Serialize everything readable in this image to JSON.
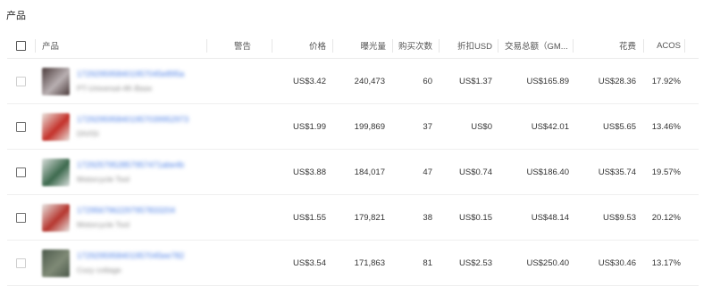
{
  "section_title": "产品",
  "columns": {
    "product": "产品",
    "warning": "警告",
    "price": "价格",
    "impressions": "曝光量",
    "purchases": "购买次数",
    "discount": "折扣USD",
    "gmv": "交易总额（GM...",
    "spend": "花费",
    "acos": "ACOS"
  },
  "rows": [
    {
      "product_id": "1729295958401957045e895a",
      "product_name": "PT-Universal-4K-Base",
      "thumb_colors": [
        "#4b3b3b",
        "#b9b0b2"
      ],
      "price": "US$3.42",
      "impressions": "240,473",
      "purchases": "60",
      "discount": "US$1.37",
      "gmv": "US$165.89",
      "spend": "US$28.36",
      "acos": "17.92%"
    },
    {
      "product_id": "1729295958401957039952973",
      "product_name": "DIVISI",
      "thumb_colors": [
        "#e9e3dd",
        "#c4312a"
      ],
      "price": "US$1.99",
      "impressions": "199,869",
      "purchases": "37",
      "discount": "US$0",
      "gmv": "US$42.01",
      "spend": "US$5.65",
      "acos": "13.46%"
    },
    {
      "product_id": "1729257952857957471abe4b",
      "product_name": "Motorcycle Tool",
      "thumb_colors": [
        "#d8dedb",
        "#3d6a4e"
      ],
      "price": "US$3.88",
      "impressions": "184,017",
      "purchases": "47",
      "discount": "US$0.74",
      "gmv": "US$186.40",
      "spend": "US$35.74",
      "acos": "19.57%"
    },
    {
      "product_id": "1729567962297957833204",
      "product_name": "Motorcycle Tool",
      "thumb_colors": [
        "#e8e5e2",
        "#b6362f"
      ],
      "price": "US$1.55",
      "impressions": "179,821",
      "purchases": "38",
      "discount": "US$0.15",
      "gmv": "US$48.14",
      "spend": "US$9.53",
      "acos": "20.12%"
    },
    {
      "product_id": "1729295958401957045ee782",
      "product_name": "Cozy cottage",
      "thumb_colors": [
        "#4d5a4c",
        "#7f8a76"
      ],
      "price": "US$3.54",
      "impressions": "171,863",
      "purchases": "81",
      "discount": "US$2.53",
      "gmv": "US$250.40",
      "spend": "US$30.46",
      "acos": "13.17%"
    }
  ]
}
